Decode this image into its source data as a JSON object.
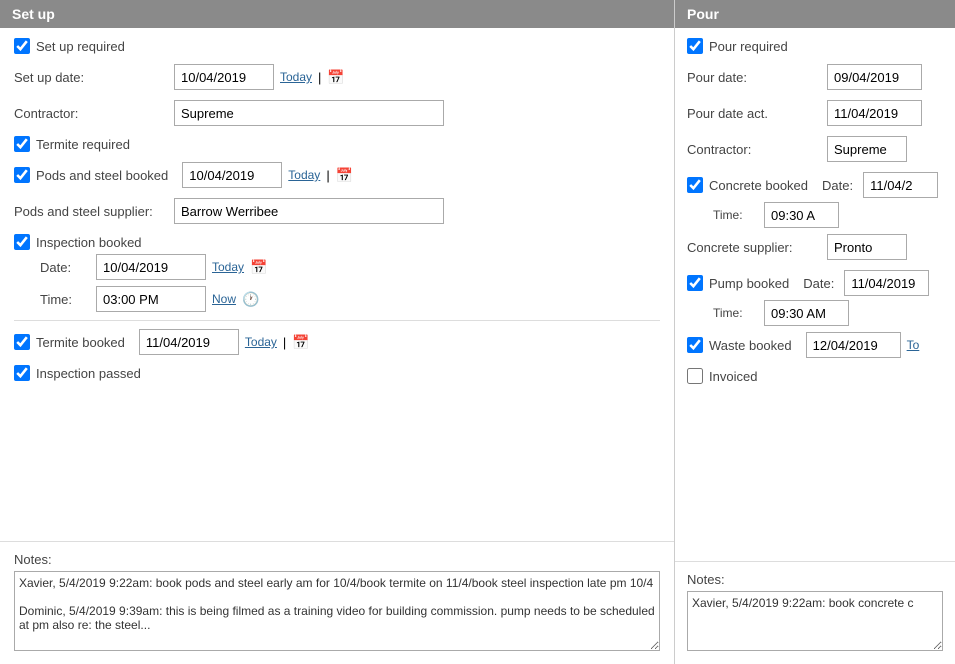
{
  "left": {
    "header": "Set up",
    "setup_required_label": "Set up required",
    "setup_date_label": "Set up date:",
    "setup_date_value": "10/04/2019",
    "today_label": "Today",
    "contractor_label": "Contractor:",
    "contractor_value": "Supreme",
    "termite_required_label": "Termite required",
    "pods_steel_label": "Pods and steel booked",
    "pods_steel_date": "10/04/2019",
    "pods_supplier_label": "Pods and steel supplier:",
    "pods_supplier_value": "Barrow Werribee",
    "inspection_booked_label": "Inspection booked",
    "inspection_date_label": "Date:",
    "inspection_date_value": "10/04/2019",
    "inspection_time_label": "Time:",
    "inspection_time_value": "03:00 PM",
    "now_label": "Now",
    "termite_booked_label": "Termite booked",
    "termite_date_value": "11/04/2019",
    "inspection_passed_label": "Inspection passed",
    "notes_label": "Notes:",
    "notes_value": "Xavier, 5/4/2019 9:22am: book pods and steel early am for 10/4/book termite on 11/4/book steel inspection late pm 10/4\n\nDominic, 5/4/2019 9:39am: this is being filmed as a training video for building commission. pump needs to be scheduled at pm also re: the steel..."
  },
  "right": {
    "header": "Pour",
    "pour_required_label": "Pour required",
    "pour_date_label": "Pour date:",
    "pour_date_value": "09/04/2019",
    "pour_date_act_label": "Pour date act.",
    "pour_date_act_value": "11/04/2019",
    "contractor_label": "Contractor:",
    "contractor_value": "Supreme",
    "concrete_booked_label": "Concrete booked",
    "concrete_date_label": "Date:",
    "concrete_date_value": "11/04/2",
    "concrete_time_label": "Time:",
    "concrete_time_value": "09:30 A",
    "concrete_supplier_label": "Concrete supplier:",
    "concrete_supplier_value": "Pronto",
    "pump_booked_label": "Pump booked",
    "pump_date_label": "Date:",
    "pump_date_value": "11/04/2019",
    "pump_time_label": "Time:",
    "pump_time_value": "09:30 AM",
    "waste_booked_label": "Waste booked",
    "waste_date_value": "12/04/2019",
    "waste_today_label": "To",
    "invoiced_label": "Invoiced",
    "notes_label": "Notes:",
    "notes_value": "Xavier, 5/4/2019 9:22am: book concrete c"
  }
}
